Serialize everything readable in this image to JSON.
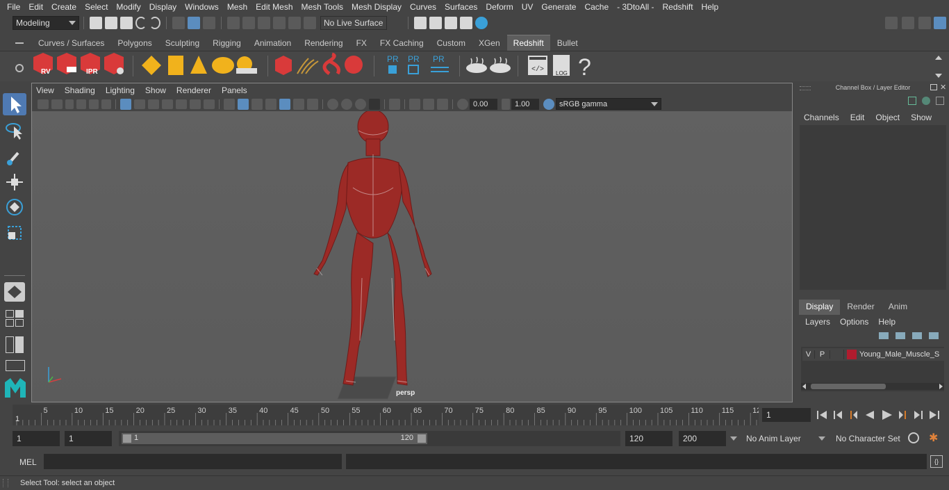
{
  "menubar": [
    "File",
    "Edit",
    "Create",
    "Select",
    "Modify",
    "Display",
    "Windows",
    "Mesh",
    "Edit Mesh",
    "Mesh Tools",
    "Mesh Display",
    "Curves",
    "Surfaces",
    "Deform",
    "UV",
    "Generate",
    "Cache",
    "- 3DtoAll -",
    "Redshift",
    "Help"
  ],
  "status": {
    "mode": "Modeling",
    "live_surface": "No Live Surface"
  },
  "shelf_tabs": [
    {
      "label": "Curves / Surfaces",
      "active": false
    },
    {
      "label": "Polygons",
      "active": false
    },
    {
      "label": "Sculpting",
      "active": false
    },
    {
      "label": "Rigging",
      "active": false
    },
    {
      "label": "Animation",
      "active": false
    },
    {
      "label": "Rendering",
      "active": false
    },
    {
      "label": "FX",
      "active": false
    },
    {
      "label": "FX Caching",
      "active": false
    },
    {
      "label": "Custom",
      "active": false
    },
    {
      "label": "XGen",
      "active": false
    },
    {
      "label": "Redshift",
      "active": true
    },
    {
      "label": "Bullet",
      "active": false
    }
  ],
  "shelf_icons": {
    "rv": "RV",
    "ipr": "IPR",
    "pr": "PR",
    "log": "LOG",
    "help": "?"
  },
  "viewport": {
    "menu": [
      "View",
      "Shading",
      "Lighting",
      "Show",
      "Renderer",
      "Panels"
    ],
    "exposure": "0.00",
    "gamma": "1.00",
    "color_space": "sRGB gamma",
    "camera": "persp"
  },
  "channel_box": {
    "title": "Channel Box / Layer Editor",
    "menu": [
      "Channels",
      "Edit",
      "Object",
      "Show"
    ],
    "layer_tabs": [
      {
        "label": "Display",
        "active": true
      },
      {
        "label": "Render",
        "active": false
      },
      {
        "label": "Anim",
        "active": false
      }
    ],
    "layer_menu": [
      "Layers",
      "Options",
      "Help"
    ],
    "layer": {
      "v": "V",
      "p": "P",
      "name": "Young_Male_Muscle_S",
      "color": "#b01c2e"
    }
  },
  "timeline": {
    "ticks": [
      "5",
      "10",
      "15",
      "20",
      "25",
      "30",
      "35",
      "40",
      "45",
      "50",
      "55",
      "60",
      "65",
      "70",
      "75",
      "80",
      "85",
      "90",
      "95",
      "100",
      "105",
      "110",
      "115",
      "12"
    ],
    "start_marker": "1",
    "current_frame": "1"
  },
  "range": {
    "start": "1",
    "current": "1",
    "slider_start": "1",
    "slider_end": "120",
    "end": "120",
    "max": "200",
    "anim_layer": "No Anim Layer",
    "char_set": "No Character Set"
  },
  "cmd": {
    "label": "MEL"
  },
  "help_line": "Select Tool: select an object",
  "colors": {
    "accent": "#5b8dbf",
    "muscle": "#9c2a26",
    "redshift": "#d93a3a"
  }
}
